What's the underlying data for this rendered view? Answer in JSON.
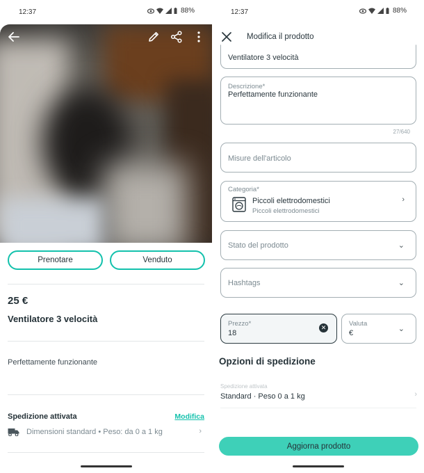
{
  "left": {
    "status": {
      "time": "12:37",
      "battery": "88%"
    },
    "actions": {
      "prenotare": "Prenotare",
      "venduto": "Venduto"
    },
    "product": {
      "price": "25 €",
      "title": "Ventilatore 3 velocità",
      "description": "Perfettamente funzionante"
    },
    "shipping": {
      "title": "Spedizione attivata",
      "edit": "Modifica",
      "details": "Dimensioni standard • Peso: da 0 a 1 kg"
    }
  },
  "right": {
    "status": {
      "time": "12:37",
      "battery": "88%"
    },
    "header": {
      "title": "Modifica il prodotto"
    },
    "form": {
      "title_value": "Ventilatore 3 velocità",
      "description_label": "Descrizione*",
      "description_value": "Perfettamente funzionante",
      "description_counter": "27/640",
      "measures_placeholder": "Misure dell'articolo",
      "category_label": "Categoria*",
      "category_value": "Piccoli elettrodomestici",
      "category_sub": "Piccoli elettrodomestici",
      "condition_placeholder": "Stato del prodotto",
      "hashtags_placeholder": "Hashtags",
      "price_label": "Prezzo*",
      "price_value": "18",
      "currency_label": "Valuta",
      "currency_value": "€"
    },
    "shipping": {
      "section_title": "Opzioni di spedizione",
      "label": "Spedizione attivata",
      "value": "Standard · Peso 0 a 1 kg"
    },
    "cta": "Aggiorna prodotto"
  },
  "colors": {
    "accent": "#13c1ac",
    "cta_bg": "#3ed0b8",
    "text": "#253238",
    "muted": "#7c8a91"
  },
  "icons": [
    "back-arrow-icon",
    "pencil-icon",
    "share-icon",
    "more-vertical-icon",
    "truck-icon",
    "chevron-right-icon",
    "close-icon",
    "washing-machine-icon",
    "chevron-down-icon",
    "clear-icon"
  ]
}
